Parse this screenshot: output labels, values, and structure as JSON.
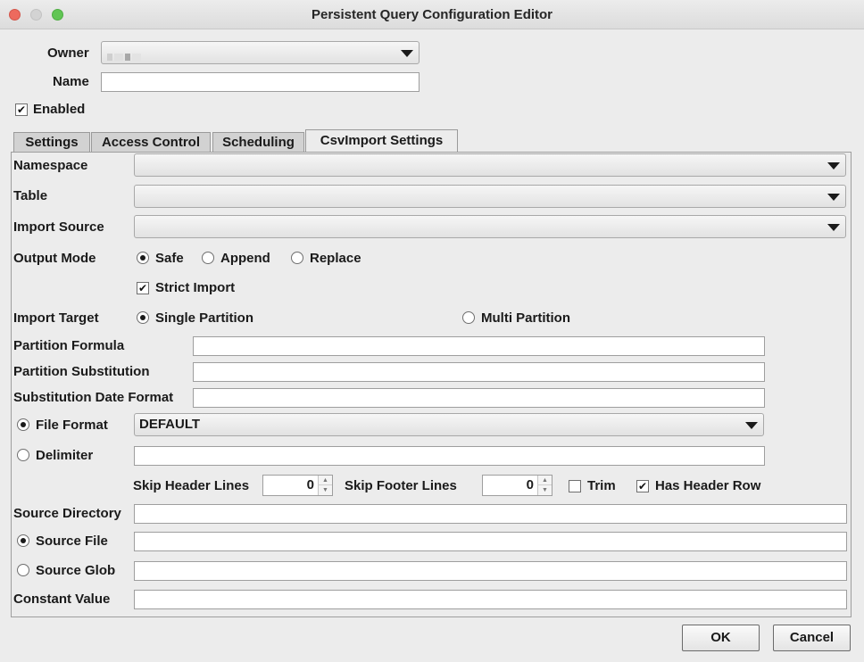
{
  "window": {
    "title": "Persistent Query Configuration Editor"
  },
  "header": {
    "owner_label": "Owner",
    "owner_value": "",
    "name_label": "Name",
    "name_value": "",
    "enabled_label": "Enabled",
    "enabled_checked": true
  },
  "tabs": [
    {
      "label": "Settings",
      "active": false
    },
    {
      "label": "Access Control",
      "active": false
    },
    {
      "label": "Scheduling",
      "active": false
    },
    {
      "label": "CsvImport Settings",
      "active": true
    }
  ],
  "csv": {
    "namespace_label": "Namespace",
    "namespace_value": "",
    "table_label": "Table",
    "table_value": "",
    "import_source_label": "Import Source",
    "import_source_value": "",
    "output_mode_label": "Output Mode",
    "output_modes": [
      "Safe",
      "Append",
      "Replace"
    ],
    "output_mode_selected": "Safe",
    "strict_import_label": "Strict Import",
    "strict_import_checked": true,
    "import_target_label": "Import Target",
    "single_partition_label": "Single Partition",
    "multi_partition_label": "Multi Partition",
    "import_target_selected": "Single Partition",
    "partition_formula_label": "Partition Formula",
    "partition_substitution_label": "Partition Substitution",
    "substitution_date_format_label": "Substitution Date Format",
    "file_format_label": "File Format",
    "file_format_value": "DEFAULT",
    "delimiter_label": "Delimiter",
    "format_selected": "File Format",
    "skip_header_label": "Skip Header Lines",
    "skip_header_value": "0",
    "skip_footer_label": "Skip Footer Lines",
    "skip_footer_value": "0",
    "trim_label": "Trim",
    "trim_checked": false,
    "has_header_label": "Has Header Row",
    "has_header_checked": true,
    "source_directory_label": "Source Directory",
    "source_file_label": "Source File",
    "source_glob_label": "Source Glob",
    "source_selected": "Source File",
    "constant_value_label": "Constant Value"
  },
  "footer": {
    "ok_label": "OK",
    "cancel_label": "Cancel"
  },
  "colors": {
    "background": "#ececec",
    "close": "#ed6a5e",
    "zoom": "#61c554"
  }
}
